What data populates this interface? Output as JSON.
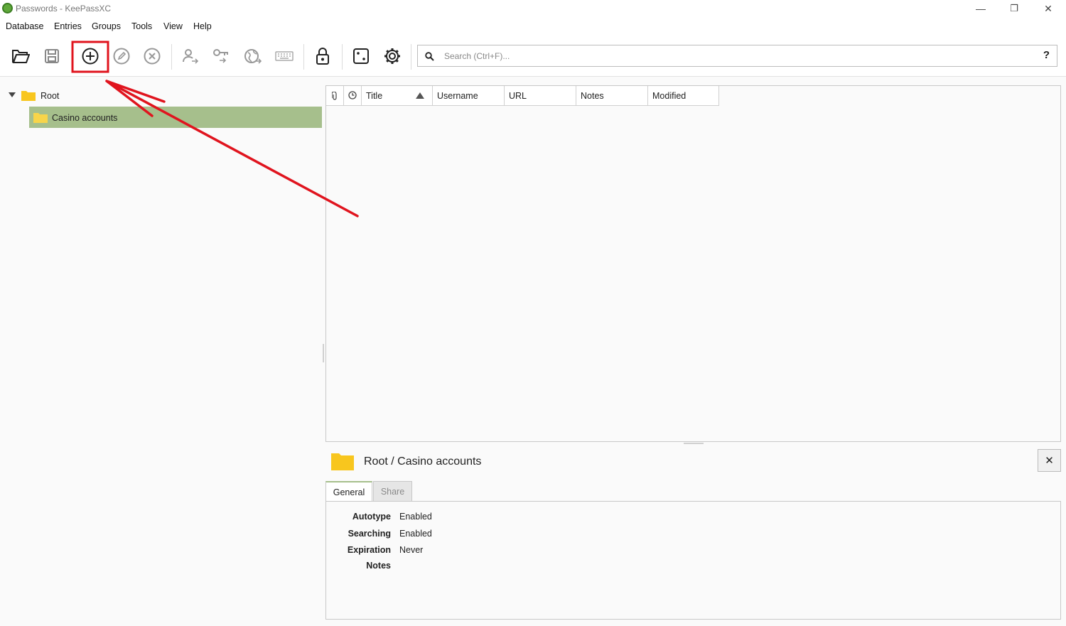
{
  "window": {
    "title": "Passwords - KeePassXC",
    "controls": {
      "minimize": "—",
      "maximize": "❐",
      "close": "✕"
    }
  },
  "menu": [
    "Database",
    "Entries",
    "Groups",
    "Tools",
    "View",
    "Help"
  ],
  "toolbar": {
    "buttons": [
      "open-database-icon",
      "save-database-icon",
      "add-entry-icon",
      "edit-entry-icon",
      "delete-entry-icon",
      "copy-username-icon",
      "copy-password-icon",
      "copy-url-icon",
      "autotype-keyboard-icon",
      "lock-database-icon",
      "password-generator-icon",
      "settings-gear-icon"
    ],
    "highlighted_button": "add-entry-icon",
    "highlight_color": "#e0141e"
  },
  "search": {
    "placeholder": "Search (Ctrl+F)...",
    "help_label": "?"
  },
  "group_tree": {
    "root_label": "Root",
    "children": [
      {
        "label": "Casino accounts",
        "selected": true
      }
    ],
    "selection_color": "#a6bf8c",
    "folder_color": "#f8c61e"
  },
  "entry_table": {
    "columns": [
      "",
      "",
      "Title",
      "Username",
      "URL",
      "Notes",
      "Modified"
    ],
    "sorted_column": "Title",
    "rows": []
  },
  "preview": {
    "path": "Root / Casino accounts",
    "close_label": "✕",
    "tabs": [
      {
        "label": "General",
        "active": true
      },
      {
        "label": "Share",
        "active": false
      }
    ],
    "properties": [
      {
        "label": "Autotype",
        "value": "Enabled"
      },
      {
        "label": "Searching",
        "value": "Enabled"
      },
      {
        "label": "Expiration",
        "value": "Never"
      },
      {
        "label": "Notes",
        "value": ""
      }
    ]
  },
  "annotation": {
    "type": "arrow",
    "color": "#e0141e",
    "points_to": "add-entry-icon"
  }
}
